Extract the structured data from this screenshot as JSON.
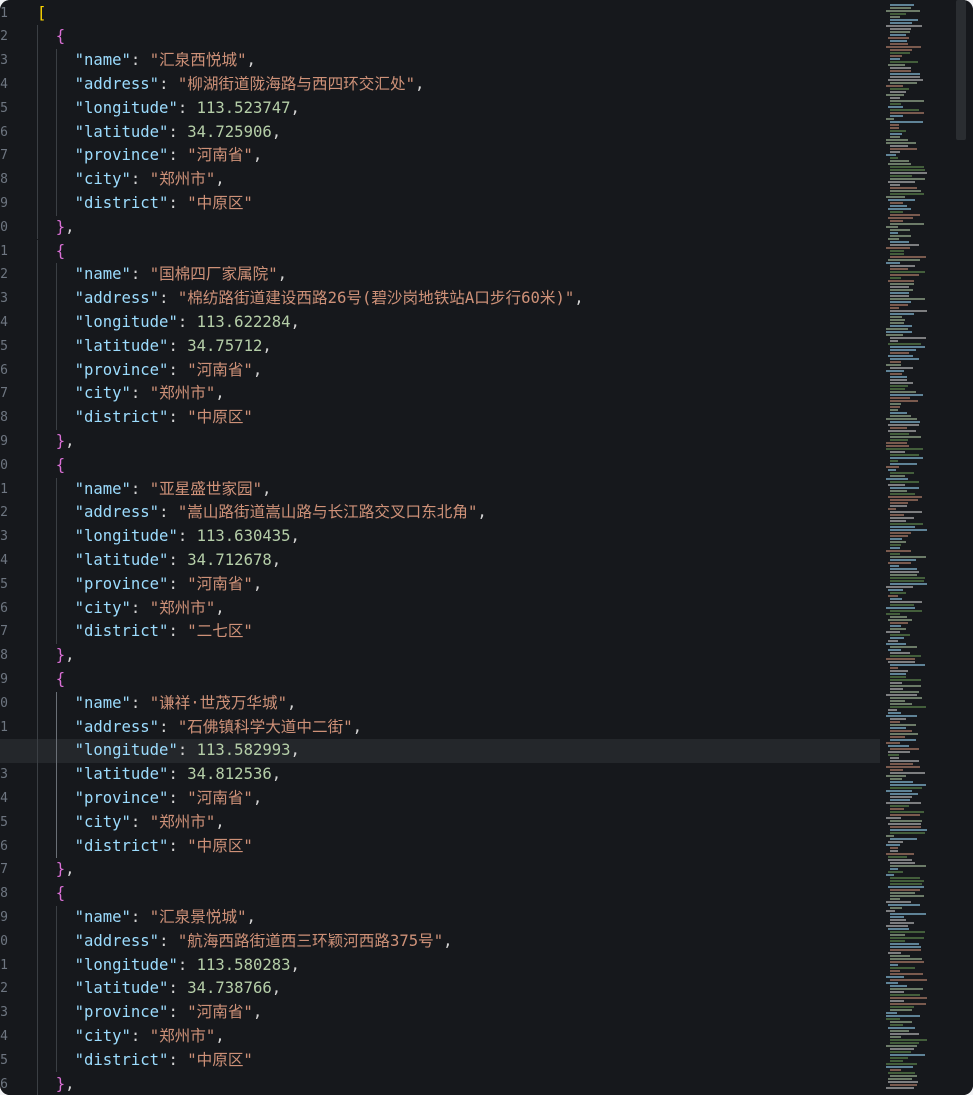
{
  "editor": {
    "open_bracket": "[",
    "current_line_index": 31,
    "records": [
      {
        "name": "汇泉西悦城",
        "address": "柳湖街道陇海路与西四环交汇处",
        "longitude": "113.523747",
        "latitude": "34.725906",
        "province": "河南省",
        "city": "郑州市",
        "district": "中原区"
      },
      {
        "name": "国棉四厂家属院",
        "address": "棉纺路街道建设西路26号(碧沙岗地铁站A口步行60米)",
        "longitude": "113.622284",
        "latitude": "34.75712",
        "province": "河南省",
        "city": "郑州市",
        "district": "中原区"
      },
      {
        "name": "亚星盛世家园",
        "address": "嵩山路街道嵩山路与长江路交叉口东北角",
        "longitude": "113.630435",
        "latitude": "34.712678",
        "province": "河南省",
        "city": "郑州市",
        "district": "二七区"
      },
      {
        "name": "谦祥·世茂万华城",
        "address": "石佛镇科学大道中二街",
        "longitude": "113.582993",
        "latitude": "34.812536",
        "province": "河南省",
        "city": "郑州市",
        "district": "中原区"
      },
      {
        "name": "汇泉景悦城",
        "address": "航海西路街道西三环颖河西路375号",
        "longitude": "113.580283",
        "latitude": "34.738766",
        "province": "河南省",
        "city": "郑州市",
        "district": "中原区"
      }
    ]
  },
  "gutter": {
    "line_numbers": [
      "1",
      "2",
      "3",
      "4",
      "5",
      "6",
      "7",
      "8",
      "9",
      "0",
      "1",
      "2",
      "3",
      "4",
      "5",
      "6",
      "7",
      "8",
      "9",
      "0",
      "1",
      "2",
      "3",
      "4",
      "5",
      "6",
      "7",
      "8",
      "9",
      "0",
      "1",
      "2",
      "3",
      "4",
      "5",
      "6",
      "7",
      "8",
      "9",
      "0",
      "1",
      "2",
      "3",
      "4",
      "5",
      "6"
    ]
  },
  "colors": {
    "background": "#16181c",
    "key": "#9cdcfe",
    "string": "#ce9178",
    "number": "#b5cea8",
    "bracket_outer": "#ffd700",
    "bracket_inner": "#da70d6",
    "line_number": "#6e7681",
    "current_line": "#24272b"
  }
}
